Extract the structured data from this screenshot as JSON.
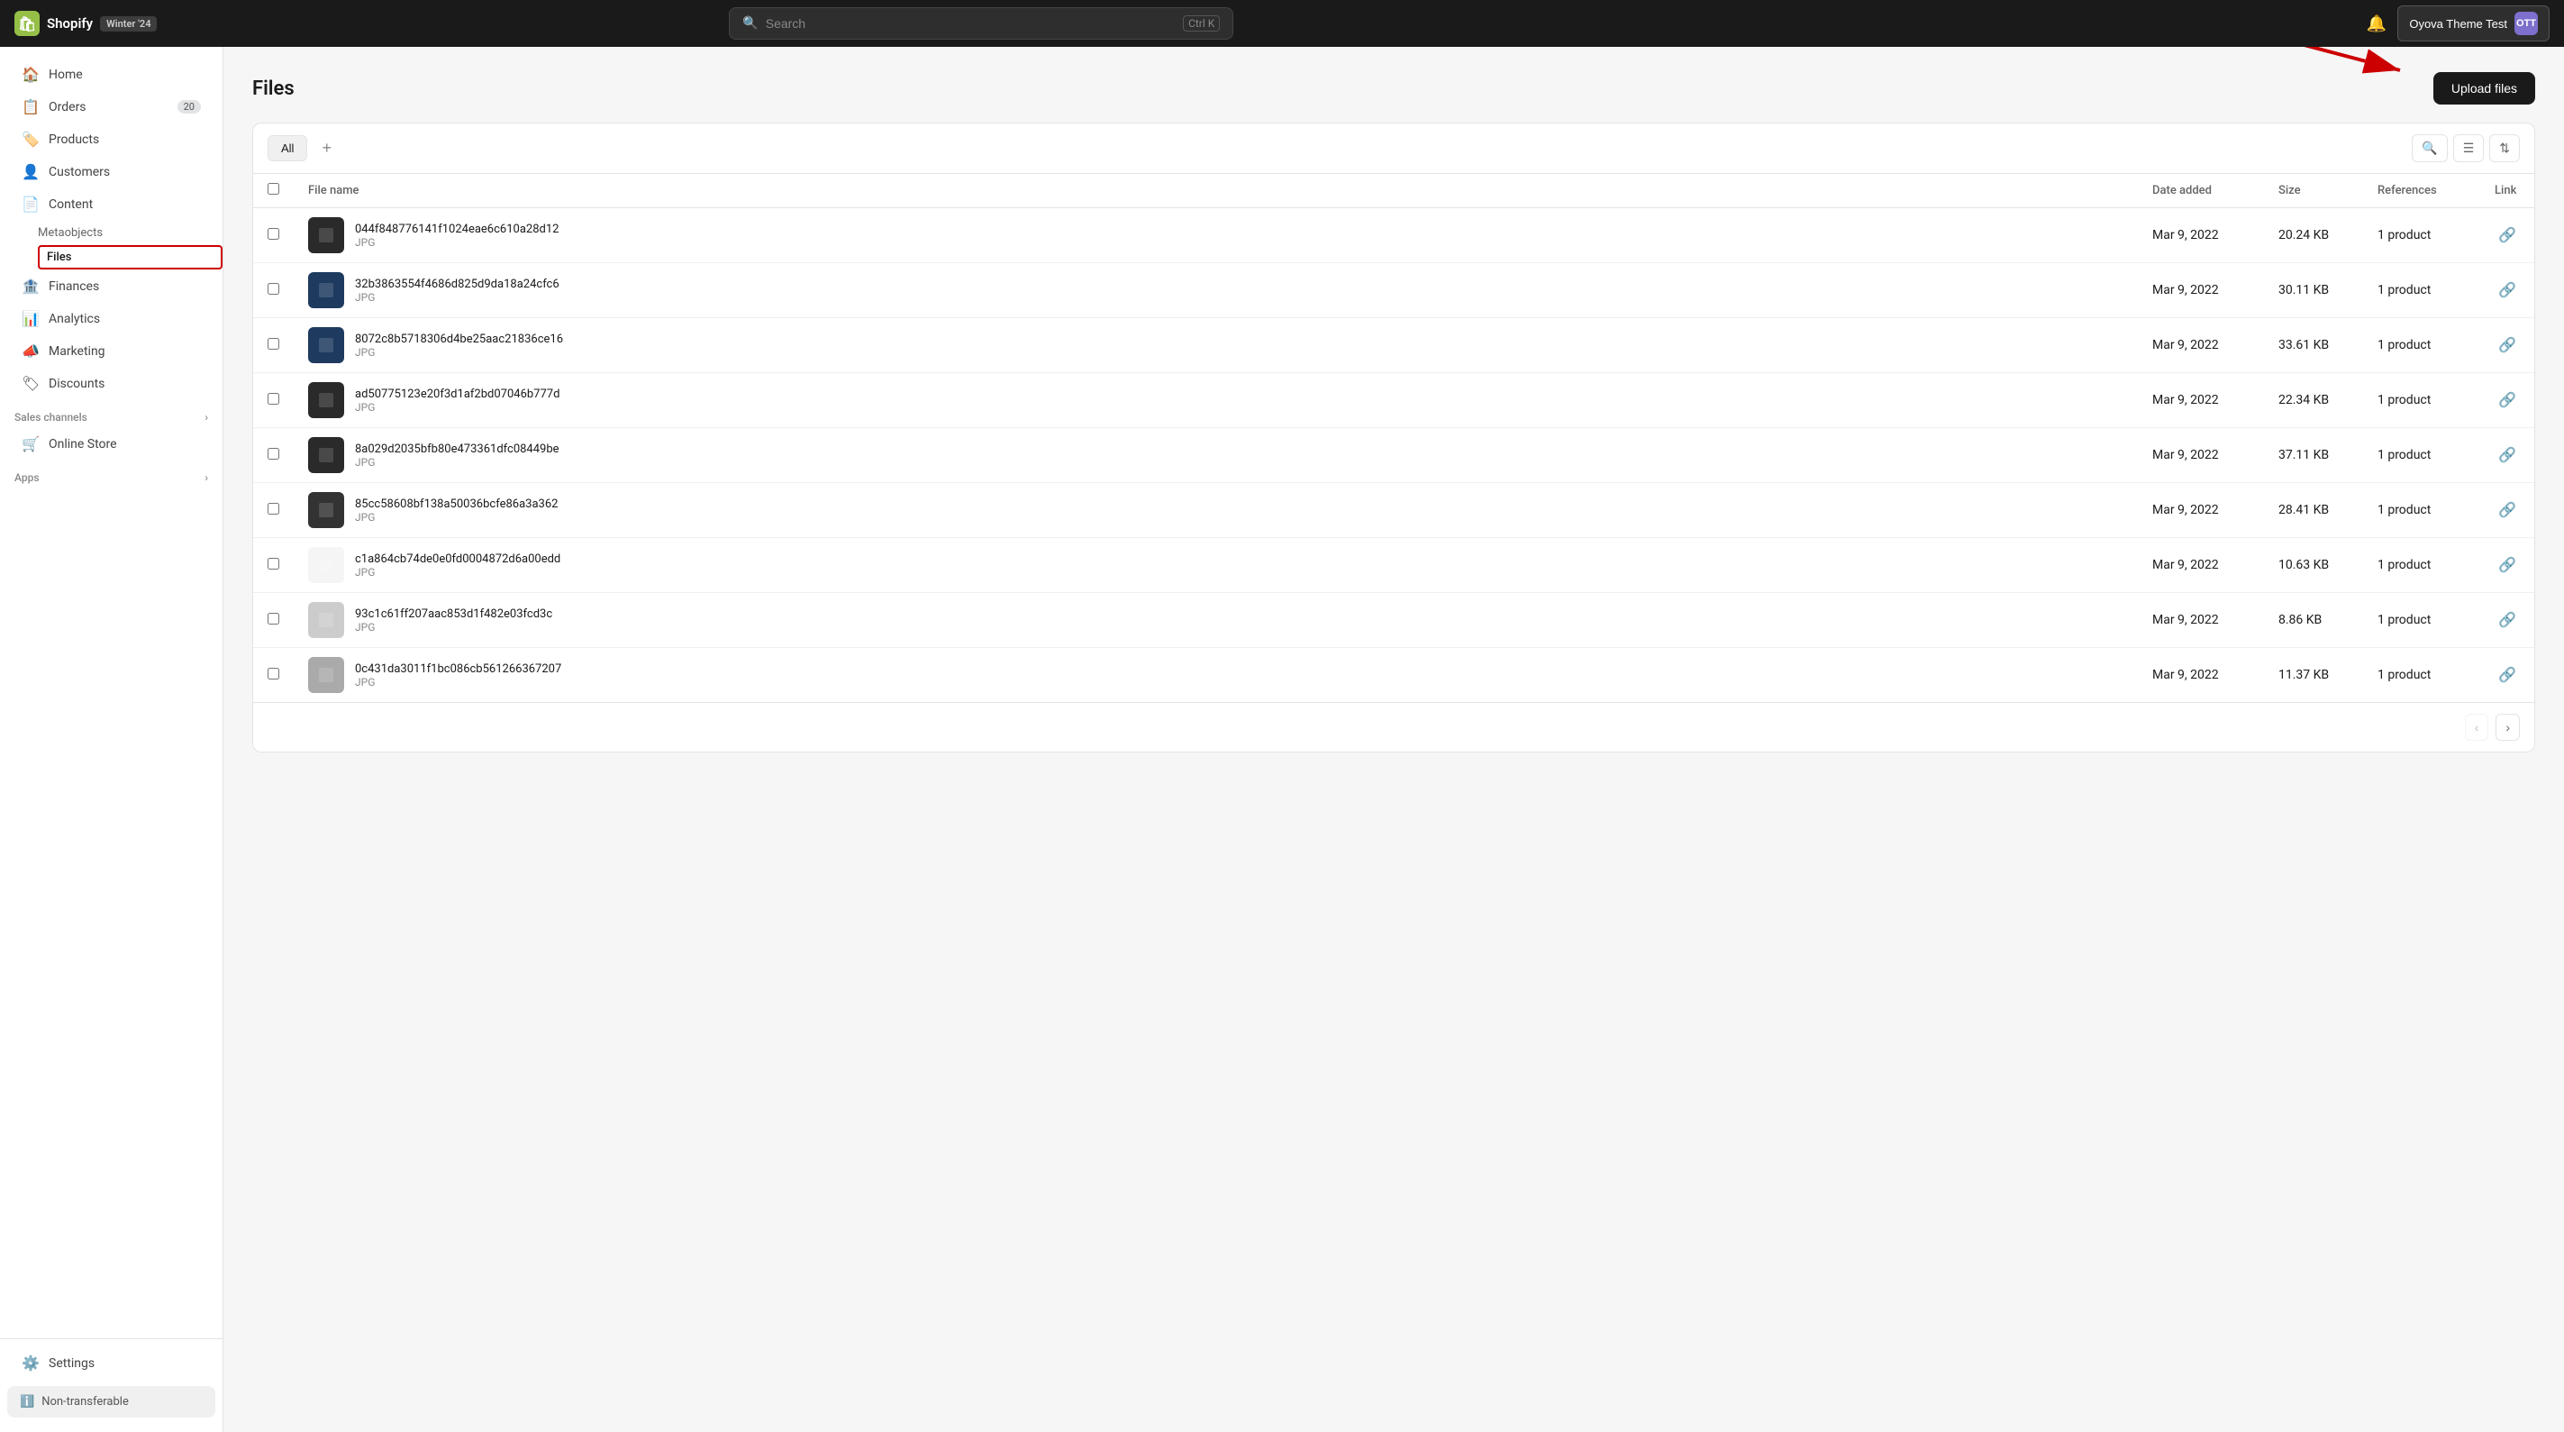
{
  "app": {
    "name": "Shopify",
    "badge": "Winter '24",
    "search_placeholder": "Search",
    "search_shortcut": "Ctrl K",
    "store_name": "Oyova Theme Test",
    "avatar_initials": "OTT"
  },
  "sidebar": {
    "items": [
      {
        "id": "home",
        "label": "Home",
        "icon": "🏠",
        "badge": null
      },
      {
        "id": "orders",
        "label": "Orders",
        "icon": "📋",
        "badge": "20"
      },
      {
        "id": "products",
        "label": "Products",
        "icon": "🏷️",
        "badge": null
      },
      {
        "id": "customers",
        "label": "Customers",
        "icon": "👤",
        "badge": null
      },
      {
        "id": "content",
        "label": "Content",
        "icon": "📄",
        "badge": null
      }
    ],
    "content_sub": [
      {
        "id": "metaobjects",
        "label": "Metaobjects",
        "active": false
      },
      {
        "id": "files",
        "label": "Files",
        "active": true
      }
    ],
    "items2": [
      {
        "id": "finances",
        "label": "Finances",
        "icon": "🏦",
        "badge": null
      },
      {
        "id": "analytics",
        "label": "Analytics",
        "icon": "📊",
        "badge": null
      },
      {
        "id": "marketing",
        "label": "Marketing",
        "icon": "📣",
        "badge": null
      },
      {
        "id": "discounts",
        "label": "Discounts",
        "icon": "🏷",
        "badge": null
      }
    ],
    "sales_channels_label": "Sales channels",
    "online_store_label": "Online Store",
    "apps_label": "Apps",
    "settings_label": "Settings",
    "non_transferable_label": "Non-transferable"
  },
  "page": {
    "title": "Files",
    "upload_button_label": "Upload files"
  },
  "toolbar": {
    "filter_all_label": "All",
    "add_filter_icon": "+",
    "search_icon": "🔍",
    "filter_icon": "☰",
    "sort_icon": "⇅"
  },
  "table": {
    "columns": [
      {
        "id": "filename",
        "label": "File name"
      },
      {
        "id": "date",
        "label": "Date added"
      },
      {
        "id": "size",
        "label": "Size"
      },
      {
        "id": "references",
        "label": "References"
      },
      {
        "id": "link",
        "label": "Link"
      }
    ],
    "rows": [
      {
        "id": 1,
        "name": "044f848776141f1024eae6c610a28d12",
        "ext": "JPG",
        "date": "Mar 9, 2022",
        "size": "20.24 KB",
        "refs": "1 product",
        "color": "#2a2a2a"
      },
      {
        "id": 2,
        "name": "32b3863554f4686d825d9da18a24cfc6",
        "ext": "JPG",
        "date": "Mar 9, 2022",
        "size": "30.11 KB",
        "refs": "1 product",
        "color": "#1e3a5f"
      },
      {
        "id": 3,
        "name": "8072c8b5718306d4be25aac21836ce16",
        "ext": "JPG",
        "date": "Mar 9, 2022",
        "size": "33.61 KB",
        "refs": "1 product",
        "color": "#1e3a5f"
      },
      {
        "id": 4,
        "name": "ad50775123e20f3d1af2bd07046b777d",
        "ext": "JPG",
        "date": "Mar 9, 2022",
        "size": "22.34 KB",
        "refs": "1 product",
        "color": "#2a2a2a"
      },
      {
        "id": 5,
        "name": "8a029d2035bfb80e473361dfc08449be",
        "ext": "JPG",
        "date": "Mar 9, 2022",
        "size": "37.11 KB",
        "refs": "1 product",
        "color": "#2a2a2a"
      },
      {
        "id": 6,
        "name": "85cc58608bf138a50036bcfe86a3a362",
        "ext": "JPG",
        "date": "Mar 9, 2022",
        "size": "28.41 KB",
        "refs": "1 product",
        "color": "#333"
      },
      {
        "id": 7,
        "name": "c1a864cb74de0e0fd0004872d6a00edd",
        "ext": "JPG",
        "date": "Mar 9, 2022",
        "size": "10.63 KB",
        "refs": "1 product",
        "color": "#f5f5f5"
      },
      {
        "id": 8,
        "name": "93c1c61ff207aac853d1f482e03fcd3c",
        "ext": "JPG",
        "date": "Mar 9, 2022",
        "size": "8.86 KB",
        "refs": "1 product",
        "color": "#ccc"
      },
      {
        "id": 9,
        "name": "0c431da3011f1bc086cb561266367207",
        "ext": "JPG",
        "date": "Mar 9, 2022",
        "size": "11.37 KB",
        "refs": "1 product",
        "color": "#aaa"
      }
    ]
  }
}
